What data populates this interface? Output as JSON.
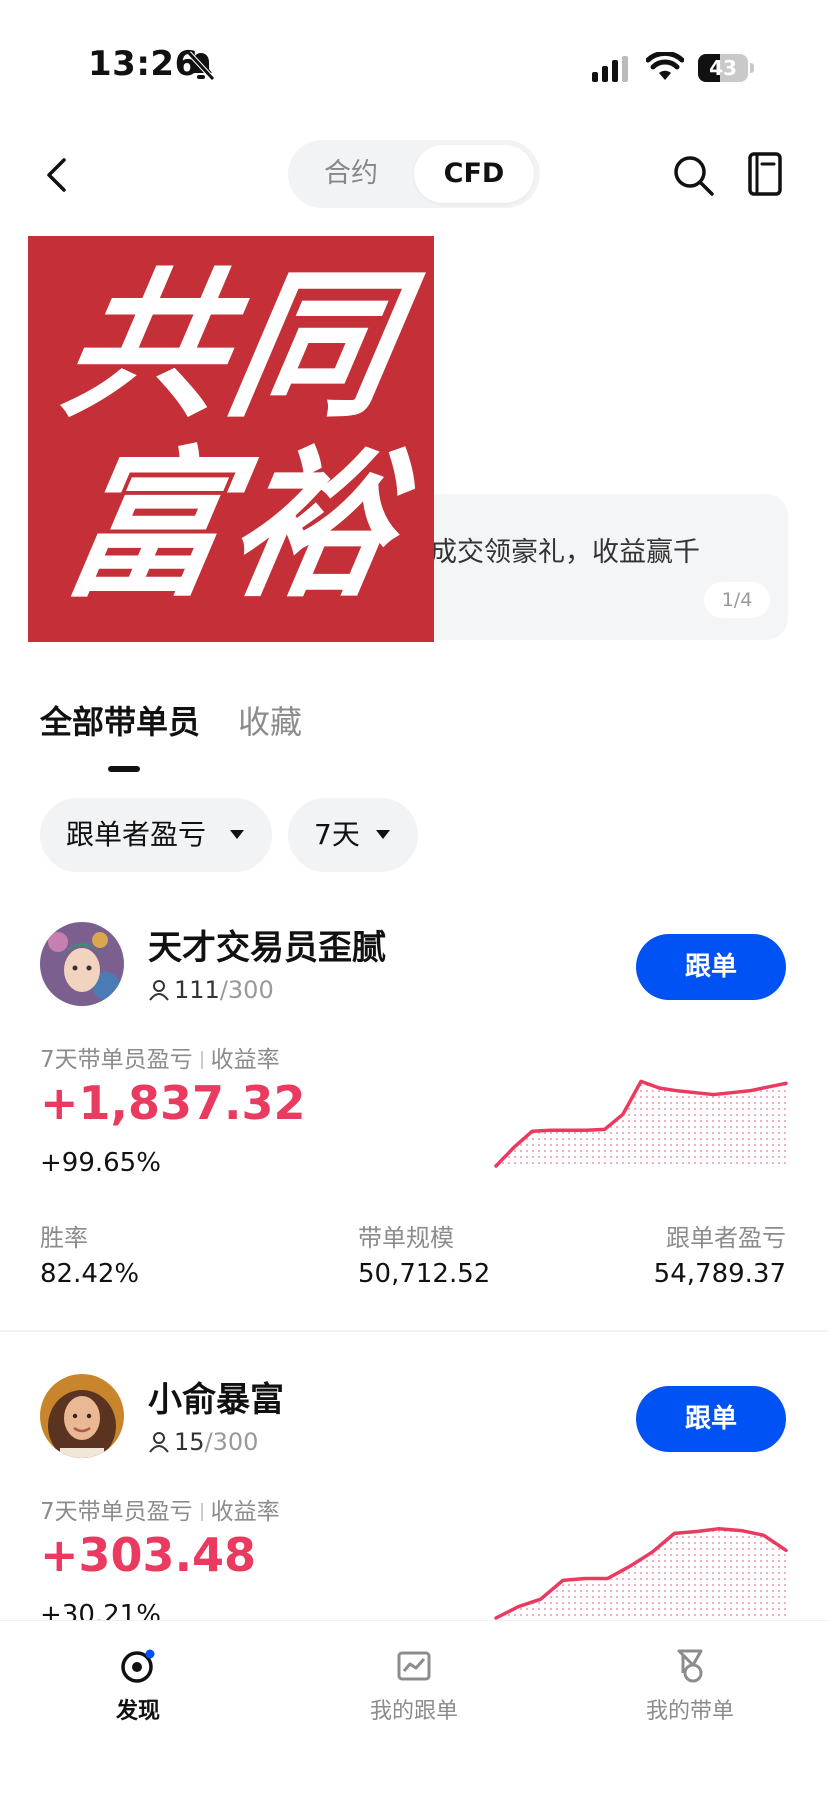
{
  "status_bar": {
    "time": "13:26",
    "battery": "43",
    "battery_level_percent": 43,
    "icons": [
      "bell-slash-icon",
      "signal-icon",
      "wifi-icon",
      "battery-icon"
    ]
  },
  "nav": {
    "tabs": [
      "合约",
      "CFD"
    ],
    "selected_tab": "CFD",
    "icons": [
      "chevron-left-icon",
      "search-icon",
      "book-icon"
    ]
  },
  "banner": {
    "logo_chars": [
      "共",
      "同",
      "富",
      "裕"
    ],
    "text": "成交领豪礼，收益赢千",
    "page_indicator": "1/4",
    "colors": {
      "logo_bg": "#c42f38"
    }
  },
  "tabs": {
    "all_traders": "全部带单员",
    "favorites": "收藏",
    "selected": "全部带单员"
  },
  "filters": {
    "sort": "跟单者盈亏",
    "period": "7天"
  },
  "traders": [
    {
      "name": "天才交易员歪腻",
      "followers": "111",
      "followers_max": "/300",
      "pnl_label": "7天带单员盈亏",
      "roi_label": "收益率",
      "pnl": "+1,837.32",
      "roi": "+99.65%",
      "follow_button": "跟单",
      "stats": {
        "win_rate_label": "胜率",
        "win_rate": "82.42%",
        "scale_label": "带单规模",
        "scale": "50,712.52",
        "follower_pnl_label": "跟单者盈亏",
        "follower_pnl": "54,789.37"
      },
      "trend": [
        0.0,
        0.2,
        0.37,
        0.38,
        0.38,
        0.38,
        0.39,
        0.55,
        0.9,
        0.83,
        0.8,
        0.78,
        0.76,
        0.78,
        0.8,
        0.84,
        0.88
      ]
    },
    {
      "name": "小俞暴富",
      "followers": "15",
      "followers_max": "/300",
      "pnl_label": "7天带单员盈亏",
      "roi_label": "收益率",
      "pnl": "+303.48",
      "roi": "+30.21%",
      "follow_button": "跟单",
      "trend": [
        0.0,
        0.12,
        0.2,
        0.4,
        0.42,
        0.42,
        0.55,
        0.7,
        0.9,
        0.92,
        0.95,
        0.93,
        0.88,
        0.72
      ]
    }
  ],
  "bottom_nav": {
    "discover": "发现",
    "my_follows": "我的跟单",
    "my_leads": "我的带单",
    "selected": "发现"
  },
  "colors": {
    "accent": "#0052f5",
    "profit": "#ea3a60",
    "muted": "#8c8c8c"
  }
}
